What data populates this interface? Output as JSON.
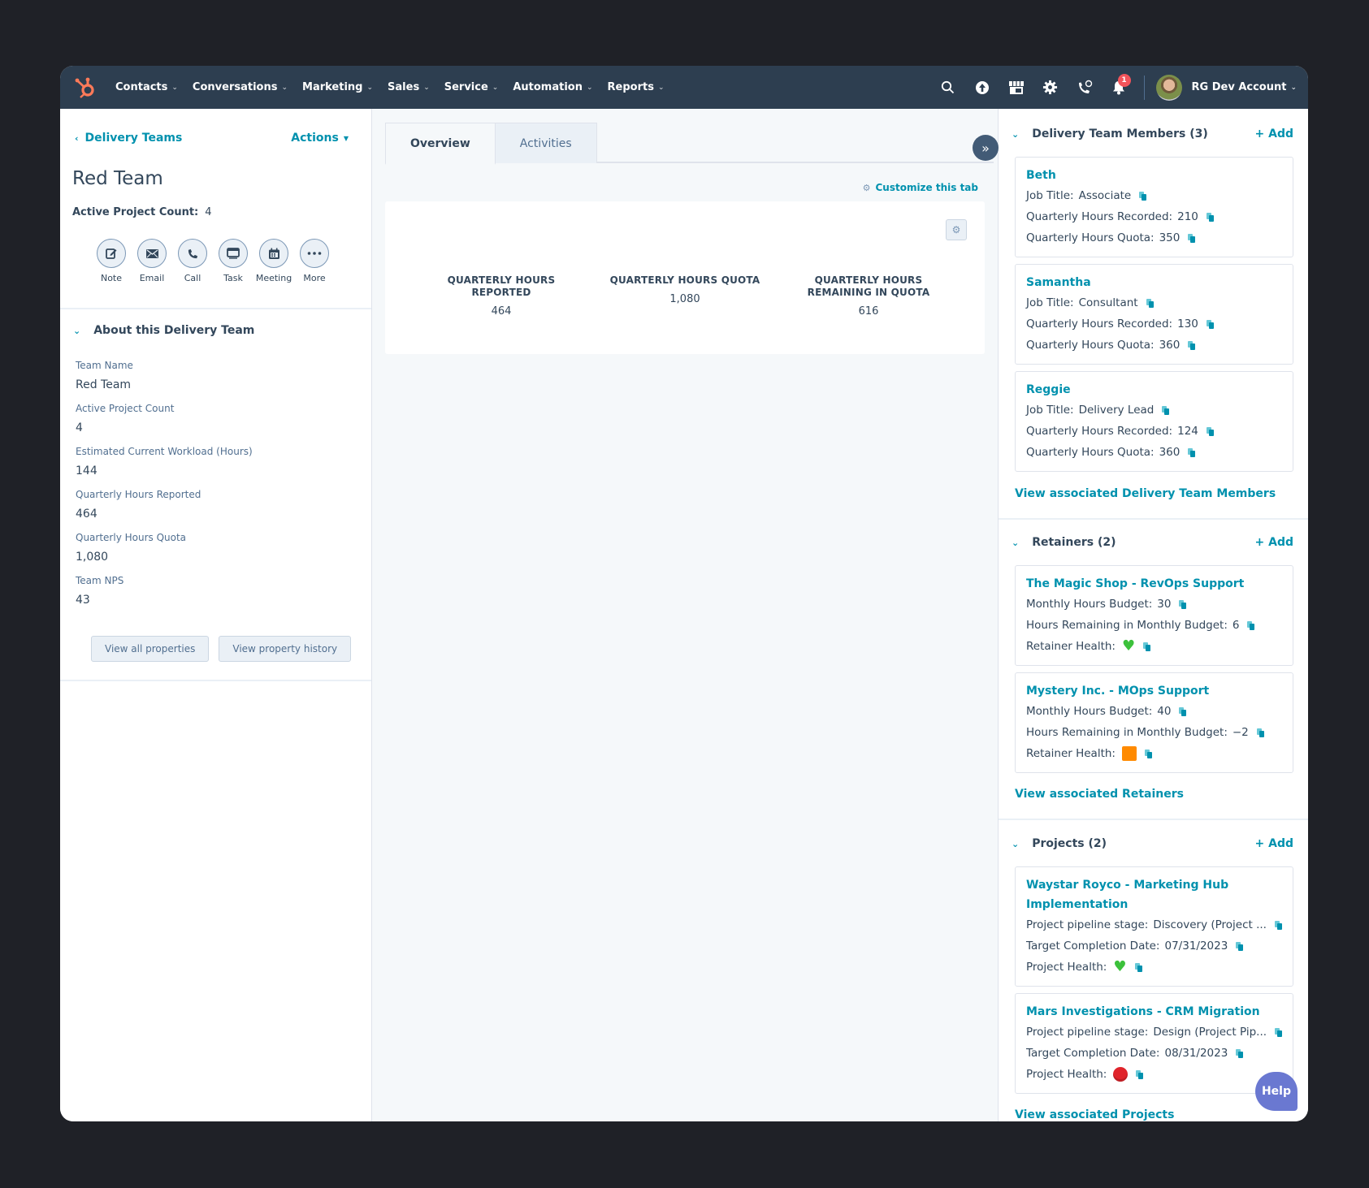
{
  "nav": {
    "items": [
      {
        "label": "Contacts"
      },
      {
        "label": "Conversations"
      },
      {
        "label": "Marketing"
      },
      {
        "label": "Sales"
      },
      {
        "label": "Service"
      },
      {
        "label": "Automation"
      },
      {
        "label": "Reports"
      }
    ],
    "notification_count": "1",
    "account_name": "RG Dev Account",
    "icons": [
      "search-icon",
      "upgrade-icon",
      "marketplace-icon",
      "settings-icon",
      "calling-icon",
      "notifications-icon"
    ]
  },
  "left": {
    "breadcrumb": "Delivery Teams",
    "actions_label": "Actions",
    "record_title": "Red Team",
    "summary_label": "Active Project Count:",
    "summary_value": "4",
    "activity_actions": [
      {
        "label": "Note"
      },
      {
        "label": "Email"
      },
      {
        "label": "Call"
      },
      {
        "label": "Task"
      },
      {
        "label": "Meeting"
      },
      {
        "label": "More"
      }
    ],
    "about_header": "About this Delivery Team",
    "properties": [
      {
        "label": "Team Name",
        "value": "Red Team"
      },
      {
        "label": "Active Project Count",
        "value": "4"
      },
      {
        "label": "Estimated Current Workload (Hours)",
        "value": "144"
      },
      {
        "label": "Quarterly Hours Reported",
        "value": "464"
      },
      {
        "label": "Quarterly Hours Quota",
        "value": "1,080"
      },
      {
        "label": "Team NPS",
        "value": "43"
      }
    ],
    "view_all_properties": "View all properties",
    "view_property_history": "View property history"
  },
  "middle": {
    "tabs": [
      {
        "label": "Overview",
        "active": true
      },
      {
        "label": "Activities",
        "active": false
      }
    ],
    "customize_label": "Customize this tab",
    "stats": [
      {
        "label": "QUARTERLY HOURS REPORTED",
        "value": "464"
      },
      {
        "label": "QUARTERLY HOURS QUOTA",
        "value": "1,080"
      },
      {
        "label": "QUARTERLY HOURS REMAINING IN QUOTA",
        "value": "616"
      }
    ]
  },
  "right": {
    "add_label": "+ Add",
    "members": {
      "header": "Delivery Team Members (3)",
      "items": [
        {
          "name": "Beth",
          "job_title_label": "Job Title:",
          "job_title": "Associate",
          "recorded_label": "Quarterly Hours Recorded:",
          "recorded": "210",
          "quota_label": "Quarterly Hours Quota:",
          "quota": "350"
        },
        {
          "name": "Samantha",
          "job_title_label": "Job Title:",
          "job_title": "Consultant",
          "recorded_label": "Quarterly Hours Recorded:",
          "recorded": "130",
          "quota_label": "Quarterly Hours Quota:",
          "quota": "360"
        },
        {
          "name": "Reggie",
          "job_title_label": "Job Title:",
          "job_title": "Delivery Lead",
          "recorded_label": "Quarterly Hours Recorded:",
          "recorded": "124",
          "quota_label": "Quarterly Hours Quota:",
          "quota": "360"
        }
      ],
      "view_link": "View associated Delivery Team Members"
    },
    "retainers": {
      "header": "Retainers (2)",
      "items": [
        {
          "name": "The Magic Shop - RevOps Support",
          "budget_label": "Monthly Hours Budget:",
          "budget": "30",
          "remaining_label": "Hours Remaining in Monthly Budget:",
          "remaining": "6",
          "health_label": "Retainer Health:",
          "health": "green-heart"
        },
        {
          "name": "Mystery Inc. - MOps Support",
          "budget_label": "Monthly Hours Budget:",
          "budget": "40",
          "remaining_label": "Hours Remaining in Monthly Budget:",
          "remaining": "−2",
          "health_label": "Retainer Health:",
          "health": "orange-square"
        }
      ],
      "view_link": "View associated Retainers"
    },
    "projects": {
      "header": "Projects (2)",
      "items": [
        {
          "name_line1": "Waystar Royco - Marketing Hub",
          "name_line2": "Implementation",
          "stage_label": "Project pipeline stage:",
          "stage": "Discovery (Project ...",
          "date_label": "Target Completion Date:",
          "date": "07/31/2023",
          "health_label": "Project Health:",
          "health": "green-heart"
        },
        {
          "name_line1": "Mars Investigations - CRM Migration",
          "stage_label": "Project pipeline stage:",
          "stage": "Design (Project Pip...",
          "date_label": "Target Completion Date:",
          "date": "08/31/2023",
          "health_label": "Project Health:",
          "health": "stop-sign"
        }
      ],
      "view_link": "View associated Projects"
    },
    "help_label": "Help"
  },
  "colors": {
    "nav_bg": "#2d3e50",
    "link": "#0091ae",
    "text": "#33475b",
    "badge": "#f2545b",
    "help": "#6a78d1",
    "logo": "#ff7a59"
  }
}
